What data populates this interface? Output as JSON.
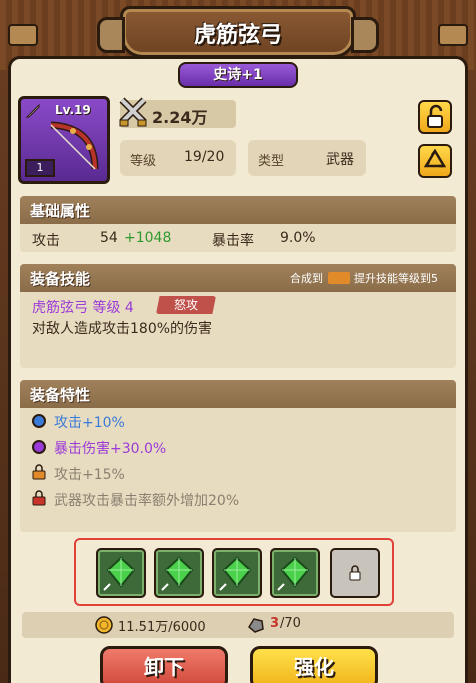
{
  "title": "虎筋弦弓",
  "rarity": "史诗+1",
  "item": {
    "level_text": "Lv.19",
    "count": "1"
  },
  "power": "2.24万",
  "stats": {
    "level_label": "等级",
    "level_value": "19/20",
    "type_label": "类型",
    "type_value": "武器"
  },
  "base_attrs": {
    "title": "基础属性",
    "attack_label": "攻击",
    "attack_value": "54",
    "attack_bonus": "+1048",
    "crit_label": "暴击率",
    "crit_value": "9.0%"
  },
  "skill": {
    "title": "装备技能",
    "hint_prefix": "合成到",
    "hint_suffix": "提升技能等级到5",
    "name": "虎筋弦弓 等级 4",
    "tag": "怒攻",
    "desc": "对敌人造成攻击180%的伤害"
  },
  "traits": {
    "title": "装备特性",
    "items": [
      {
        "text": "攻击+10%",
        "color": "#3a7ad8",
        "icon": "blue-dot-icon"
      },
      {
        "text": "暴击伤害+30.0%",
        "color": "#9a3ad8",
        "icon": "purple-dot-icon"
      },
      {
        "text": "攻击+15%",
        "color": "#8a8070",
        "icon": "orange-lock-icon"
      },
      {
        "text": "武器攻击暴击率额外增加20%",
        "color": "#8a8070",
        "icon": "red-lock-icon"
      }
    ]
  },
  "resources": {
    "gold": "11.51万/6000",
    "stone_have": "3",
    "stone_need": "/70"
  },
  "buttons": {
    "unequip": "卸下",
    "upgrade": "强化"
  }
}
